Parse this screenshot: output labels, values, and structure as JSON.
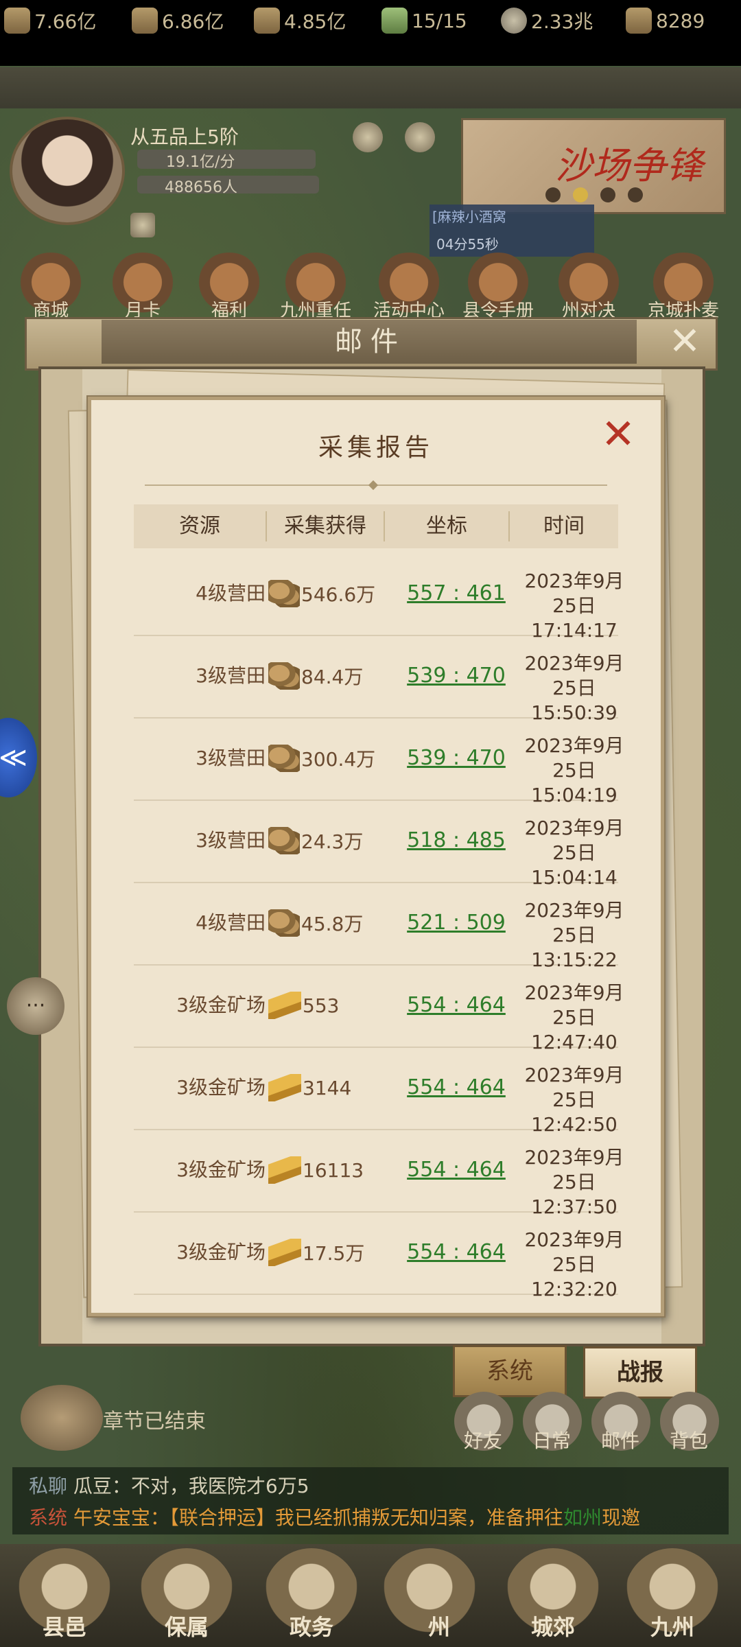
{
  "resources": [
    {
      "icon": "grain-icon",
      "value": "7.66亿"
    },
    {
      "icon": "wood-icon",
      "value": "6.86亿"
    },
    {
      "icon": "logs-icon",
      "value": "4.85亿"
    },
    {
      "icon": "stamina-icon",
      "value": "15/15"
    },
    {
      "icon": "coin-icon",
      "value": "2.33兆"
    },
    {
      "icon": "gold-ingot-icon",
      "value": "8289"
    }
  ],
  "player": {
    "rank": "从五品上5阶",
    "rate": "19.1亿/分",
    "population": "488656人"
  },
  "banner": {
    "title": "沙场争锋"
  },
  "timer": {
    "name": "[麻辣小酒窝",
    "value": "04分55秒"
  },
  "features": [
    "商城",
    "月卡",
    "福利",
    "九州重任",
    "活动中心",
    "县令手册",
    "州对决",
    "京城扑麦"
  ],
  "mail": {
    "title": "邮件",
    "tabs": {
      "system": "系统",
      "battle": "战报"
    }
  },
  "report": {
    "title": "采集报告",
    "columns": [
      "资源",
      "采集获得",
      "坐标",
      "时间"
    ],
    "rows": [
      {
        "resource": "4级营田",
        "type": "grain",
        "amount": "546.6万",
        "coord": "557 : 461",
        "date": "2023年9月25日",
        "time": "17:14:17"
      },
      {
        "resource": "3级营田",
        "type": "grain",
        "amount": "84.4万",
        "coord": "539 : 470",
        "date": "2023年9月25日",
        "time": "15:50:39"
      },
      {
        "resource": "3级营田",
        "type": "grain",
        "amount": "300.4万",
        "coord": "539 : 470",
        "date": "2023年9月25日",
        "time": "15:04:19"
      },
      {
        "resource": "3级营田",
        "type": "grain",
        "amount": "24.3万",
        "coord": "518 : 485",
        "date": "2023年9月25日",
        "time": "15:04:14"
      },
      {
        "resource": "4级营田",
        "type": "grain",
        "amount": "45.8万",
        "coord": "521 : 509",
        "date": "2023年9月25日",
        "time": "13:15:22"
      },
      {
        "resource": "3级金矿场",
        "type": "gold",
        "amount": "553",
        "coord": "554 : 464",
        "date": "2023年9月25日",
        "time": "12:47:40"
      },
      {
        "resource": "3级金矿场",
        "type": "gold",
        "amount": "3144",
        "coord": "554 : 464",
        "date": "2023年9月25日",
        "time": "12:42:50"
      },
      {
        "resource": "3级金矿场",
        "type": "gold",
        "amount": "16113",
        "coord": "554 : 464",
        "date": "2023年9月25日",
        "time": "12:37:50"
      },
      {
        "resource": "3级金矿场",
        "type": "gold",
        "amount": "17.5万",
        "coord": "554 : 464",
        "date": "2023年9月25日",
        "time": "12:32:20"
      }
    ]
  },
  "chapter": "章节已结束",
  "quick_buttons": [
    "好友",
    "日常",
    "邮件",
    "背包"
  ],
  "chat": [
    {
      "tag": "私聊",
      "text": "瓜豆：不对，我医院才6万5",
      "highlight": ""
    },
    {
      "tag": "系统",
      "text": "午安宝宝：【联合押运】我已经抓捕叛无知归案，准备押往",
      "highlight": "如州",
      "tail": "现邀"
    }
  ],
  "nav": [
    "县邑",
    "保属",
    "政务",
    "州",
    "城郊",
    "九州"
  ],
  "side_chat_icon": "···",
  "side_blue_icon": "≪"
}
